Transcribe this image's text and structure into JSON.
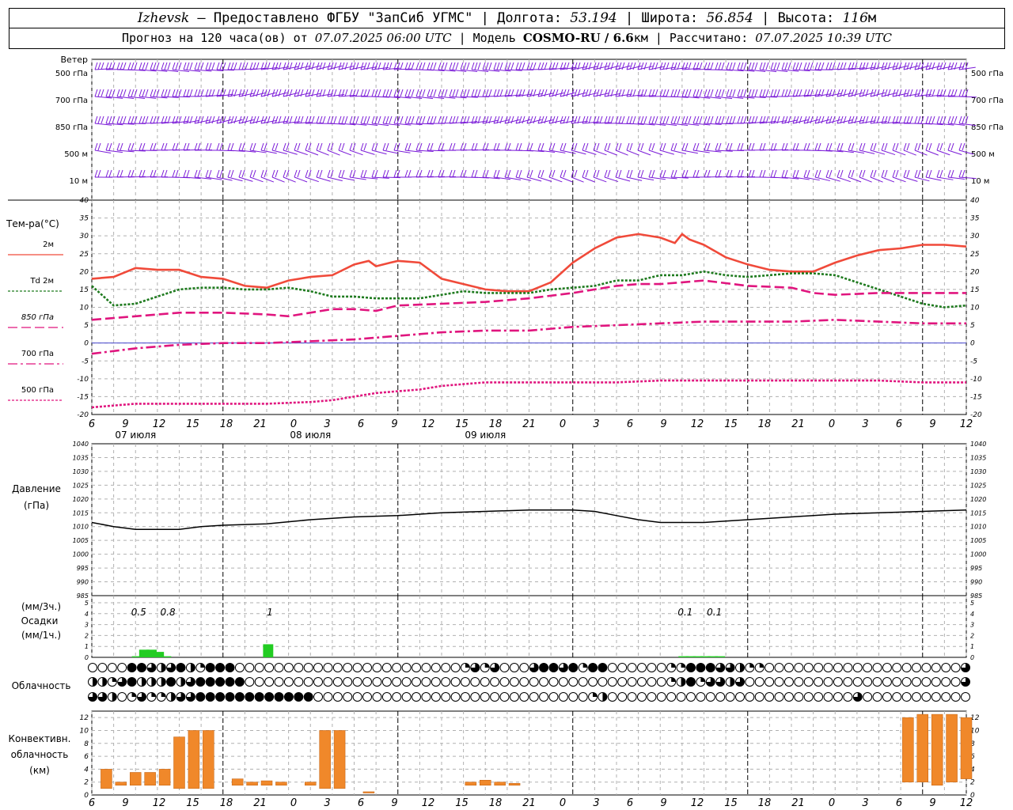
{
  "header": {
    "city": "Izhevsk",
    "provider": "— Предоставлено ФГБУ \"ЗапСиб УГМС\"",
    "lon_label": "| Долгота:",
    "lon": "53.194",
    "lat_label": "| Широта:",
    "lat": "56.854",
    "alt_label": "| Высота:",
    "alt": "116",
    "alt_unit": "м",
    "forecast_label": "Прогноз на 120 часа(ов) от",
    "forecast_start": "07.07.2025 06:00 UTC",
    "model_label": "| Модель",
    "model": "COSMO-RU / 6.6",
    "model_unit": "км",
    "calc_label": "| Рассчитано:",
    "calc_time": "07.07.2025 10:39 UTC"
  },
  "labels": {
    "wind_title": "Ветер",
    "wind_levels": [
      "500 гПа",
      "700 гПа",
      "850 гПа",
      "500 м",
      "10 м"
    ],
    "temp_title": "Тем-ра(°C)",
    "temp_legend": [
      "2м",
      "Td 2м",
      "850 гПа",
      "700 гПа",
      "500 гПа"
    ],
    "pressure_title": "Давление",
    "pressure_unit": "(гПа)",
    "precip_unit_3h": "(мм/3ч.)",
    "precip_title": "Осадки",
    "precip_unit_1h": "(мм/1ч.)",
    "cloud_title": "Облачность",
    "conv_title_1": "Конвективн.",
    "conv_title_2": "облачность",
    "conv_unit": "(км)"
  },
  "colors": {
    "t2m": "#f04a3a",
    "td2m": "#1e7a1e",
    "t850": "#e0157e",
    "t700": "#e0157e",
    "t500": "#e0157e",
    "wind": "#7a1ad8",
    "precip": "#22cc22",
    "convective": "#f0882a",
    "zero_line": "#4444cc"
  },
  "chart_data": [
    {
      "type": "line",
      "title": "Тем-ра(°C)",
      "x_ticks": [
        "6",
        "9",
        "12",
        "15",
        "18",
        "21",
        "0",
        "3",
        "6",
        "9",
        "12",
        "15",
        "18",
        "21",
        "0",
        "3",
        "6",
        "9",
        "12",
        "15",
        "18",
        "21",
        "0",
        "3",
        "6",
        "9",
        "12"
      ],
      "day_labels": [
        "07 июля",
        "08 июля",
        "09 июля"
      ],
      "ylim": [
        -20,
        40
      ],
      "y_ticks": [
        -20,
        -15,
        -10,
        -5,
        0,
        5,
        10,
        15,
        20,
        25,
        30,
        35,
        40
      ],
      "series": [
        {
          "name": "2м",
          "style": "solid",
          "x": [
            0,
            3,
            6,
            9,
            12,
            15,
            18,
            21,
            24,
            27,
            30,
            33,
            36,
            38,
            39,
            41,
            42,
            45,
            48,
            51,
            54,
            57,
            60,
            63,
            66,
            69,
            72,
            75,
            78,
            80,
            81,
            82,
            84,
            87,
            90,
            93,
            96,
            99,
            102,
            105,
            108,
            111,
            114,
            117,
            120
          ],
          "values": [
            18,
            18.5,
            21,
            20.5,
            20.5,
            18.5,
            18,
            16,
            15.5,
            17.5,
            18.5,
            19,
            22,
            23,
            21.5,
            22.5,
            23,
            22.5,
            18,
            16.5,
            15,
            14.5,
            14.5,
            17,
            22.5,
            26.5,
            29.5,
            30.5,
            29.5,
            28,
            30.5,
            29,
            27.5,
            24,
            22,
            20.5,
            20,
            20,
            22.5,
            24.5,
            26,
            26.5,
            27.5,
            27.5,
            27
          ]
        },
        {
          "name": "Td 2м",
          "style": "dotted",
          "x": [
            0,
            3,
            6,
            9,
            12,
            15,
            18,
            21,
            24,
            27,
            30,
            33,
            36,
            39,
            42,
            45,
            48,
            51,
            54,
            57,
            60,
            63,
            66,
            69,
            72,
            75,
            78,
            81,
            84,
            87,
            90,
            93,
            96,
            99,
            102,
            105,
            108,
            111,
            114,
            117,
            120
          ],
          "values": [
            16,
            10.5,
            11,
            13,
            15,
            15.5,
            15.5,
            15,
            15,
            15.5,
            14.5,
            13,
            13,
            12.5,
            12.5,
            12.5,
            13.5,
            14.5,
            14,
            14,
            14,
            15,
            15.5,
            16,
            17.5,
            17.5,
            19,
            19,
            20,
            19,
            18.5,
            19,
            19.5,
            19.5,
            19,
            17,
            15,
            13,
            11,
            10,
            10.5
          ]
        },
        {
          "name": "850 гПа",
          "style": "dashed",
          "x": [
            0,
            6,
            12,
            18,
            24,
            27,
            30,
            33,
            36,
            39,
            42,
            48,
            54,
            60,
            66,
            72,
            75,
            78,
            81,
            84,
            90,
            96,
            99,
            102,
            108,
            114,
            120
          ],
          "values": [
            6.5,
            7.5,
            8.5,
            8.5,
            8,
            7.5,
            8.5,
            9.5,
            9.5,
            9,
            10.5,
            11,
            11.5,
            12.5,
            14,
            16,
            16.5,
            16.5,
            17,
            17.5,
            16,
            15.5,
            14,
            13.5,
            14,
            14,
            14
          ]
        },
        {
          "name": "700 гПа",
          "style": "dashdot",
          "x": [
            0,
            6,
            12,
            18,
            24,
            30,
            36,
            42,
            48,
            54,
            60,
            66,
            72,
            78,
            84,
            90,
            96,
            102,
            108,
            114,
            120
          ],
          "values": [
            -3,
            -1.5,
            -0.5,
            0,
            0,
            0.5,
            1,
            2,
            3,
            3.5,
            3.5,
            4.5,
            5,
            5.5,
            6,
            6,
            6,
            6.5,
            6,
            5.5,
            5.5
          ]
        },
        {
          "name": "500 гПа",
          "style": "dotted",
          "x": [
            0,
            6,
            12,
            18,
            24,
            30,
            33,
            36,
            39,
            42,
            45,
            48,
            51,
            54,
            60,
            66,
            72,
            78,
            84,
            90,
            96,
            102,
            108,
            114,
            120
          ],
          "values": [
            -18,
            -17,
            -17,
            -17,
            -17,
            -16.5,
            -16,
            -15,
            -14,
            -13.5,
            -13,
            -12,
            -11.5,
            -11,
            -11,
            -11,
            -11,
            -10.5,
            -10.5,
            -10.5,
            -10.5,
            -10.5,
            -10.5,
            -11,
            -11
          ]
        }
      ]
    },
    {
      "type": "line",
      "title": "Давление",
      "ylabel": "(гПа)",
      "ylim": [
        985,
        1040
      ],
      "y_ticks": [
        985,
        990,
        995,
        1000,
        1005,
        1010,
        1015,
        1020,
        1025,
        1030,
        1035,
        1040
      ],
      "series": [
        {
          "name": "Давление",
          "x": [
            0,
            3,
            6,
            9,
            12,
            15,
            18,
            24,
            30,
            36,
            42,
            48,
            54,
            60,
            63,
            66,
            69,
            72,
            75,
            78,
            81,
            84,
            90,
            96,
            102,
            108,
            114,
            120
          ],
          "values": [
            1011.5,
            1010,
            1009,
            1009,
            1009,
            1010,
            1010.5,
            1011,
            1012.5,
            1013.5,
            1014,
            1015,
            1015.5,
            1016,
            1016,
            1016,
            1015.5,
            1014,
            1012.5,
            1011.5,
            1011.5,
            1011.5,
            1012.5,
            1013.5,
            1014.5,
            1015,
            1015.5,
            1016
          ]
        }
      ]
    },
    {
      "type": "bar",
      "title": "Осадки",
      "ylabel": "(мм/1ч.)",
      "ylim": [
        0,
        5
      ],
      "y_ticks": [
        0,
        1,
        2,
        3,
        4,
        5
      ],
      "x": [
        6,
        7,
        8,
        9,
        10,
        24,
        81,
        82,
        83,
        84,
        85,
        86
      ],
      "values": [
        0.1,
        0.7,
        0.7,
        0.5,
        0.1,
        1.2,
        0.1,
        0.1,
        0.1,
        0.1,
        0.1,
        0.1
      ],
      "totals_3h": [
        {
          "x": 6,
          "label": "0.5"
        },
        {
          "x": 10,
          "label": "0.8"
        },
        {
          "x": 24,
          "label": "1"
        },
        {
          "x": 81,
          "label": "0.1"
        },
        {
          "x": 85,
          "label": "0.1"
        }
      ]
    },
    {
      "type": "table",
      "title": "Облачность",
      "rows_desc": "3 rows x 48 symbols (0 clear .. 4 overcast)",
      "rows": [
        [
          0,
          0,
          0,
          0,
          0,
          4,
          4,
          4,
          3,
          2,
          1,
          3,
          4,
          4,
          2,
          1,
          4,
          4,
          4,
          4,
          4,
          0,
          0,
          0,
          0,
          0,
          0,
          0,
          0,
          0,
          0,
          0,
          0,
          0,
          0,
          0,
          0,
          0,
          0,
          0,
          0,
          0,
          0,
          0,
          0,
          0,
          0,
          0,
          0,
          0,
          0,
          0,
          0,
          0,
          1,
          3,
          1,
          3,
          3,
          0,
          0,
          0,
          0,
          0,
          3,
          4,
          4,
          4,
          3,
          4,
          3,
          1,
          4,
          4,
          3,
          0,
          0,
          0,
          0,
          0,
          0,
          0,
          0,
          1,
          4,
          1,
          4,
          4,
          4,
          4,
          2,
          3,
          3,
          2,
          2,
          1,
          1,
          0,
          0,
          0,
          0,
          0,
          0,
          0,
          0,
          0,
          0,
          0,
          0,
          0,
          0,
          0,
          0,
          0,
          0,
          0,
          0,
          0,
          0,
          0,
          0,
          0,
          0,
          0,
          0,
          0,
          3,
          4
        ],
        [
          2,
          2,
          1,
          3,
          3,
          4,
          1,
          2,
          2,
          2,
          3,
          4,
          2,
          3,
          3,
          4,
          3,
          4,
          4,
          4,
          4,
          4,
          0,
          0,
          0,
          0,
          0,
          0,
          0,
          0,
          0,
          0,
          0,
          0,
          0,
          0,
          0,
          0,
          0,
          0,
          0,
          0,
          0,
          0,
          0,
          0,
          0,
          0,
          0,
          0,
          0,
          0,
          0,
          0,
          0,
          0,
          0,
          0,
          0,
          0,
          0,
          0,
          0,
          0,
          0,
          0,
          0,
          0,
          0,
          0,
          0,
          0,
          0,
          0,
          0,
          0,
          0,
          0,
          0,
          0,
          0,
          0,
          0,
          1,
          4,
          2,
          4,
          4,
          1,
          3,
          4,
          3,
          2,
          3,
          0,
          0,
          0,
          0,
          0,
          0,
          0,
          0,
          0,
          0,
          0,
          0,
          0,
          0,
          0,
          0,
          0,
          0,
          0,
          0,
          0,
          0,
          0,
          0,
          0,
          0,
          0,
          0,
          0,
          0,
          0,
          0,
          3,
          2
        ],
        [
          3,
          3,
          3,
          2,
          0,
          3,
          1,
          3,
          3,
          1,
          1,
          1,
          2,
          2,
          3,
          3,
          4,
          4,
          4,
          4,
          4,
          4,
          4,
          4,
          4,
          4,
          4,
          4,
          4,
          4,
          4,
          4,
          4,
          4,
          4,
          0,
          0,
          0,
          0,
          0,
          0,
          0,
          0,
          0,
          0,
          0,
          0,
          0,
          0,
          0,
          0,
          0,
          0,
          0,
          0,
          0,
          0,
          0,
          0,
          0,
          0,
          0,
          0,
          0,
          0,
          0,
          0,
          0,
          0,
          0,
          0,
          0,
          0,
          0,
          0,
          0,
          0,
          0,
          0,
          1,
          4,
          2,
          0,
          0,
          0,
          0,
          0,
          0,
          0,
          0,
          0,
          0,
          0,
          0,
          0,
          0,
          0,
          0,
          0,
          0,
          0,
          0,
          0,
          0,
          0,
          0,
          0,
          0,
          0,
          0,
          0,
          0,
          0,
          0,
          0,
          0,
          0,
          0,
          0,
          0,
          0,
          4,
          3,
          0,
          0,
          0,
          0,
          0,
          0,
          0,
          0,
          0,
          0,
          0,
          0,
          0,
          0,
          0,
          0,
          0,
          0
        ]
      ]
    },
    {
      "type": "bar",
      "title": "Конвективн. облачность",
      "ylabel": "(км)",
      "ylim": [
        0,
        13
      ],
      "y_ticks": [
        0,
        2,
        4,
        6,
        8,
        10,
        12
      ],
      "bars": [
        {
          "x": 1,
          "base": 1,
          "top": 4
        },
        {
          "x": 2,
          "base": 1.5,
          "top": 2
        },
        {
          "x": 3,
          "base": 1.5,
          "top": 3.5
        },
        {
          "x": 4,
          "base": 1.5,
          "top": 3.5
        },
        {
          "x": 5,
          "base": 1.5,
          "top": 4
        },
        {
          "x": 6,
          "base": 1,
          "top": 9
        },
        {
          "x": 7,
          "base": 1,
          "top": 10
        },
        {
          "x": 8,
          "base": 1,
          "top": 10
        },
        {
          "x": 10,
          "base": 1.5,
          "top": 2.5
        },
        {
          "x": 11,
          "base": 1.5,
          "top": 2
        },
        {
          "x": 12,
          "base": 1.5,
          "top": 2.2
        },
        {
          "x": 13,
          "base": 1.5,
          "top": 2
        },
        {
          "x": 15,
          "base": 1.5,
          "top": 2
        },
        {
          "x": 16,
          "base": 1,
          "top": 10
        },
        {
          "x": 17,
          "base": 1,
          "top": 10
        },
        {
          "x": 19,
          "base": 0.3,
          "top": 0.5
        },
        {
          "x": 26,
          "base": 1.5,
          "top": 2
        },
        {
          "x": 27,
          "base": 1.5,
          "top": 2.3
        },
        {
          "x": 28,
          "base": 1.5,
          "top": 2
        },
        {
          "x": 29,
          "base": 1.5,
          "top": 1.8
        },
        {
          "x": 56,
          "base": 2,
          "top": 12
        },
        {
          "x": 57,
          "base": 2,
          "top": 12.5
        },
        {
          "x": 58,
          "base": 1.5,
          "top": 12.5
        },
        {
          "x": 59,
          "base": 2,
          "top": 12.5
        },
        {
          "x": 60,
          "base": 2.5,
          "top": 12
        }
      ],
      "x_note": "x in 2-hour steps from 06 UTC"
    }
  ]
}
